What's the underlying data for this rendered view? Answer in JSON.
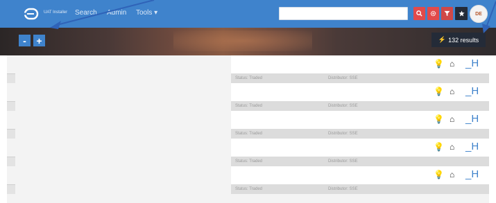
{
  "app": {
    "brand": "UAT Installer",
    "nav": [
      {
        "label": "Search"
      },
      {
        "label": "Admin"
      },
      {
        "label": "Tools ▾"
      }
    ],
    "search": {
      "placeholder": ""
    },
    "toolbar_icons": [
      "search-icon",
      "gear-icon",
      "filter-icon",
      "star-icon"
    ],
    "avatar_initials": "DE"
  },
  "banner": {
    "zoom_out_label": "-",
    "zoom_in_label": "+",
    "results_label": "132 results"
  },
  "results": [
    {
      "status": "Status: Traded",
      "distributor": "Distributor: SSE",
      "code": "_H"
    },
    {
      "status": "Status: Traded",
      "distributor": "Distributor: SSE",
      "code": "_H"
    },
    {
      "status": "Status: Traded",
      "distributor": "Distributor: SSE",
      "code": "_H"
    },
    {
      "status": "Status: Traded",
      "distributor": "Distributor: SSE",
      "code": "_H"
    },
    {
      "status": "Status: Traded",
      "distributor": "Distributor: SSE",
      "code": "_H"
    }
  ],
  "colors": {
    "primary": "#3f83cc",
    "danger": "#e24a4a",
    "dark": "#242b38",
    "bulb": "#f0b14a"
  }
}
